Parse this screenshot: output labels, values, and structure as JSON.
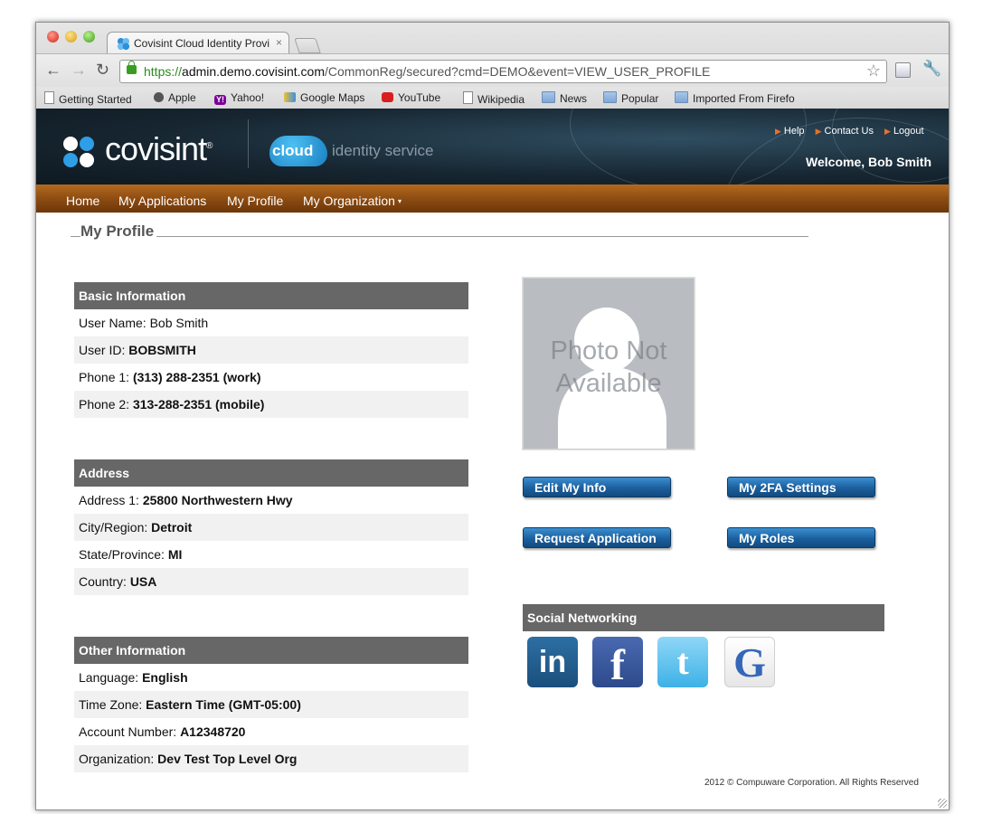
{
  "browser": {
    "tab_title": "Covisint Cloud Identity Provi",
    "tab_close": "×",
    "url_scheme": "https://",
    "url_host": "admin.demo.covisint.com",
    "url_path": "/CommonReg/secured?cmd=DEMO&event=VIEW_USER_PROFILE",
    "back_glyph": "←",
    "forward_glyph": "→",
    "reload_glyph": "↻",
    "star_glyph": "☆",
    "wrench_glyph": "🔧",
    "bookmarks": [
      "Getting Started",
      "Apple",
      "Yahoo!",
      "Google Maps",
      "YouTube",
      "Wikipedia",
      "News",
      "Popular",
      "Imported From Firefo"
    ],
    "yahoo_badge": "Y!"
  },
  "header": {
    "logo_text": "covisint",
    "logo_mark": "®",
    "cloud_label": "cloud",
    "cloud_tagline": "identity service",
    "links": [
      "Help",
      "Contact Us",
      "Logout"
    ],
    "welcome": "Welcome, Bob Smith"
  },
  "nav": {
    "items": [
      "Home",
      "My Applications",
      "My Profile",
      "My Organization"
    ],
    "caret": "▾"
  },
  "page": {
    "title": "My Profile"
  },
  "basic": {
    "heading": "Basic Information",
    "rows": [
      {
        "label": "User Name: ",
        "value": "Bob Smith"
      },
      {
        "label": "User ID: ",
        "value": "BOBSMITH"
      },
      {
        "label": "Phone 1: ",
        "value": "(313) 288-2351 (work)"
      },
      {
        "label": "Phone 2: ",
        "value": "313-288-2351 (mobile)"
      }
    ]
  },
  "address": {
    "heading": "Address",
    "rows": [
      {
        "label": "Address 1: ",
        "value": "25800 Northwestern Hwy"
      },
      {
        "label": "City/Region: ",
        "value": "Detroit"
      },
      {
        "label": "State/Province: ",
        "value": "MI"
      },
      {
        "label": "Country: ",
        "value": "USA"
      }
    ]
  },
  "other": {
    "heading": "Other Information",
    "rows": [
      {
        "label": "Language: ",
        "value": "English"
      },
      {
        "label": "Time Zone: ",
        "value": "Eastern Time (GMT-05:00)"
      },
      {
        "label": "Account Number: ",
        "value": "A12348720"
      },
      {
        "label": "Organization: ",
        "value": "Dev Test Top Level Org"
      }
    ]
  },
  "photo": {
    "placeholder_line1": "Photo Not",
    "placeholder_line2": "Available"
  },
  "actions": {
    "edit_info": "Edit My Info",
    "twofa": "My 2FA Settings",
    "request_app": "Request Application",
    "roles": "My Roles"
  },
  "social": {
    "heading": "Social Networking",
    "linkedin": "in",
    "facebook": "f",
    "twitter": "t",
    "google": "G"
  },
  "footer": {
    "text": "2012 © Compuware Corporation. All Rights Reserved"
  },
  "colors": {
    "nav_bar": "#8a4a10",
    "section_header": "#676767",
    "button": "#1b5f9e",
    "header_bg": "#162530"
  }
}
